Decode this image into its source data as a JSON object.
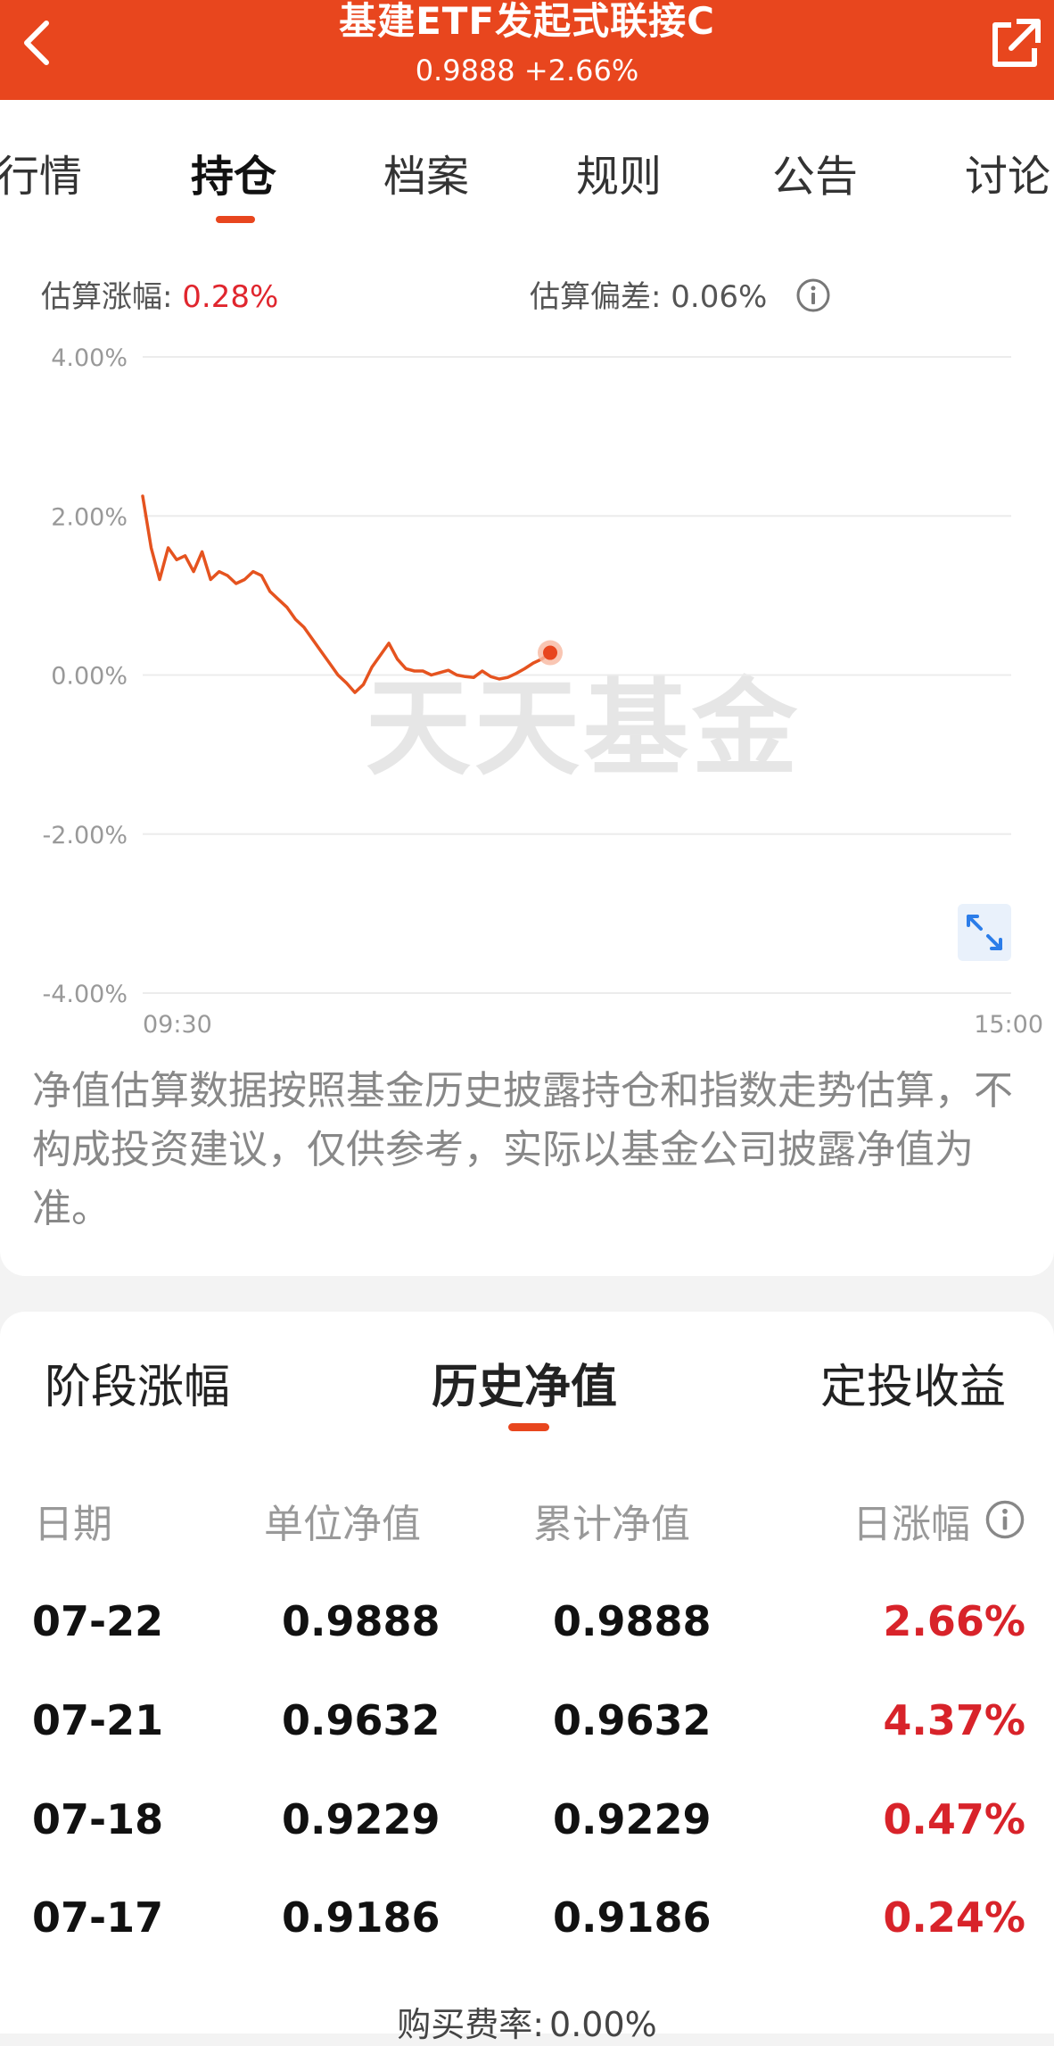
{
  "header": {
    "title": "基建ETF发起式联接C",
    "nav": "0.9888",
    "change": "+2.66%",
    "bg_color": "#e8461e"
  },
  "tabs": [
    {
      "label": "行情"
    },
    {
      "label": "持仓",
      "active": true
    },
    {
      "label": "档案"
    },
    {
      "label": "规则"
    },
    {
      "label": "公告"
    },
    {
      "label": "讨论"
    }
  ],
  "estimate": {
    "change_label": "估算涨幅:",
    "change_value": "0.28%",
    "deviation_label": "估算偏差:",
    "deviation_value": "0.06%"
  },
  "chart_data": {
    "type": "line",
    "y_ticks": [
      "4.00%",
      "2.00%",
      "0.00%",
      "-2.00%",
      "-4.00%"
    ],
    "x_ticks": [
      "09:30",
      "15:00"
    ],
    "ylim": [
      -4,
      4
    ],
    "watermark": "天天基金",
    "line_color": "#e5531f",
    "series": [
      {
        "values": [
          2.25,
          1.6,
          1.2,
          1.6,
          1.45,
          1.5,
          1.3,
          1.55,
          1.2,
          1.3,
          1.25,
          1.15,
          1.2,
          1.3,
          1.25,
          1.05,
          0.95,
          0.85,
          0.7,
          0.6,
          0.45,
          0.3,
          0.15,
          0.0,
          -0.1,
          -0.22,
          -0.12,
          0.1,
          0.25,
          0.4,
          0.2,
          0.08,
          0.05,
          0.05,
          0.0,
          0.03,
          0.06,
          0.0,
          -0.02,
          -0.03,
          0.05,
          -0.02,
          -0.05,
          -0.03,
          0.02,
          0.08,
          0.15,
          0.2,
          0.28
        ]
      }
    ]
  },
  "note": "净值估算数据按照基金历史披露持仓和指数走势估算，不构成投资建议，仅供参考，实际以基金公司披露净值为准。",
  "sub_tabs": [
    {
      "label": "阶段涨幅"
    },
    {
      "label": "历史净值",
      "active": true
    },
    {
      "label": "定投收益"
    }
  ],
  "table": {
    "headers": [
      "日期",
      "单位净值",
      "累计净值",
      "日涨幅"
    ],
    "rows": [
      {
        "date": "07-22",
        "unit": "0.9888",
        "cum": "0.9888",
        "pct": "2.66%"
      },
      {
        "date": "07-21",
        "unit": "0.9632",
        "cum": "0.9632",
        "pct": "4.37%"
      },
      {
        "date": "07-18",
        "unit": "0.9229",
        "cum": "0.9229",
        "pct": "0.47%"
      },
      {
        "date": "07-17",
        "unit": "0.9186",
        "cum": "0.9186",
        "pct": "0.24%"
      }
    ]
  },
  "fee": {
    "label": "购买费率:",
    "value": "0.00%"
  }
}
